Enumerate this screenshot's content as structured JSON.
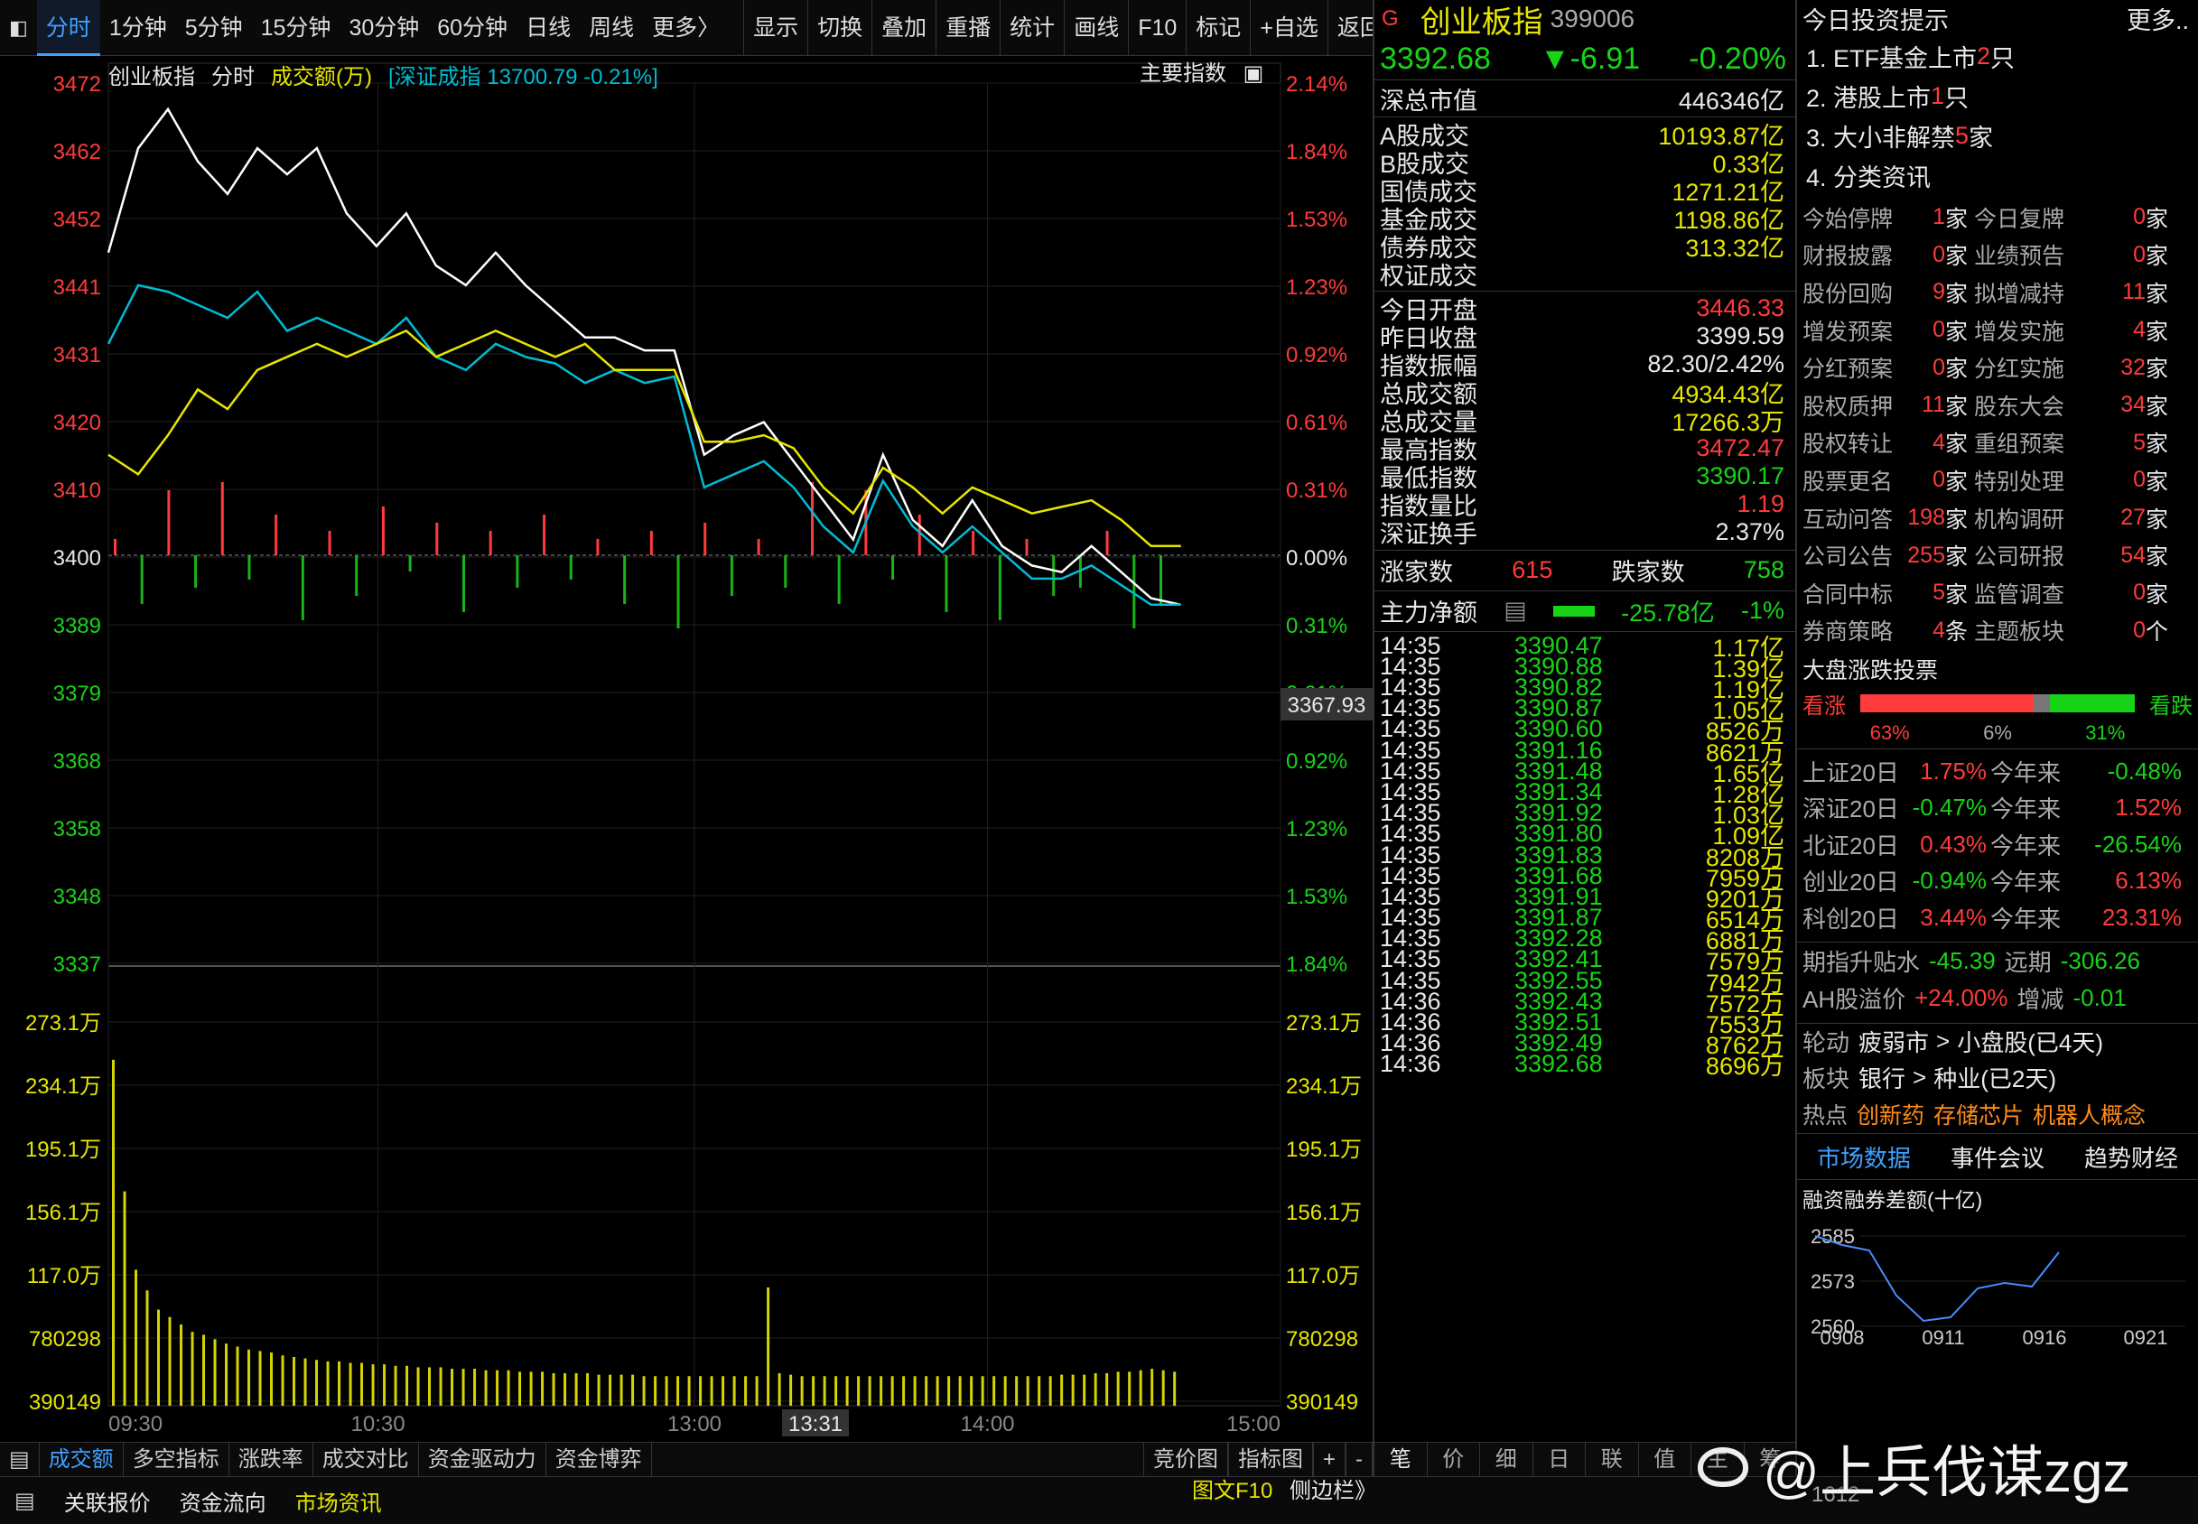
{
  "toolbar": {
    "left_items": [
      "分时",
      "1分钟",
      "5分钟",
      "15分钟",
      "30分钟",
      "60分钟",
      "日线",
      "周线",
      "更多〉"
    ],
    "right_items": [
      "显示",
      "切换",
      "叠加",
      "重播",
      "统计",
      "画线",
      "F10",
      "标记",
      "+自选",
      "返回"
    ]
  },
  "chart_header": {
    "name": "创业板指",
    "mode": "分时",
    "volume_label": "成交额(万)",
    "compare": "[深证成指 13700.79 -0.21%]",
    "index_btn": "主要指数"
  },
  "price_axis_left": [
    "3472",
    "3462",
    "3452",
    "3441",
    "3431",
    "3420",
    "3410",
    "3400",
    "3389",
    "3379",
    "3368",
    "3358",
    "3348",
    "3337"
  ],
  "price_axis_right": [
    "2.14%",
    "1.84%",
    "1.53%",
    "1.23%",
    "0.92%",
    "0.61%",
    "0.31%",
    "0.00%",
    "0.31%",
    "0.61%",
    "0.92%",
    "1.23%",
    "1.53%",
    "1.84%"
  ],
  "volume_axis": [
    "273.1万",
    "234.1万",
    "195.1万",
    "156.1万",
    "117.0万",
    "780298",
    "390149"
  ],
  "time_axis": [
    "09:30",
    "10:30",
    "13:00",
    "14:00",
    "15:00"
  ],
  "cursor_time": "13:31",
  "cursor_price": "3367.93",
  "bottom_tabs": [
    "成交额",
    "多空指标",
    "涨跌率",
    "成交对比",
    "资金驱动力",
    "资金博弈"
  ],
  "bottom_tabs_right": [
    "竞价图",
    "指标图",
    "+",
    "-"
  ],
  "status_bar": [
    "关联报价",
    "资金流向",
    "市场资讯"
  ],
  "status_bar_right": [
    "图文F10",
    "侧边栏》"
  ],
  "quote": {
    "tag": "G",
    "name": "创业板指",
    "code": "399006",
    "price": "3392.68",
    "change": "▼-6.91",
    "pct": "-0.20%"
  },
  "stats": [
    {
      "label": "深总市值",
      "value": "446346亿",
      "color": "white"
    },
    {
      "label": "A股成交",
      "value": "10193.87亿",
      "color": "yellow"
    },
    {
      "label": "B股成交",
      "value": "0.33亿",
      "color": "yellow"
    },
    {
      "label": "国债成交",
      "value": "1271.21亿",
      "color": "yellow"
    },
    {
      "label": "基金成交",
      "value": "1198.86亿",
      "color": "yellow"
    },
    {
      "label": "债券成交",
      "value": "313.32亿",
      "color": "yellow"
    },
    {
      "label": "权证成交",
      "value": "",
      "color": "yellow"
    },
    {
      "label": "今日开盘",
      "value": "3446.33",
      "color": "red"
    },
    {
      "label": "昨日收盘",
      "value": "3399.59",
      "color": "white"
    },
    {
      "label": "指数振幅",
      "value": "82.30/2.42%",
      "color": "white"
    },
    {
      "label": "总成交额",
      "value": "4934.43亿",
      "color": "yellow"
    },
    {
      "label": "总成交量",
      "value": "17266.3万",
      "color": "yellow"
    },
    {
      "label": "最高指数",
      "value": "3472.47",
      "color": "red"
    },
    {
      "label": "最低指数",
      "value": "3390.17",
      "color": "green"
    },
    {
      "label": "指数量比",
      "value": "1.19",
      "color": "red"
    },
    {
      "label": "深证换手",
      "value": "2.37%",
      "color": "white"
    }
  ],
  "updown": {
    "up_label": "涨家数",
    "up": "615",
    "down_label": "跌家数",
    "down": "758"
  },
  "main_flow": {
    "label": "主力净额",
    "value": "-25.78亿",
    "pct": "-1%"
  },
  "ticks": [
    {
      "time": "14:35",
      "price": "3390.47",
      "amount": "1.17亿"
    },
    {
      "time": "14:35",
      "price": "3390.88",
      "amount": "1.39亿"
    },
    {
      "time": "14:35",
      "price": "3390.82",
      "amount": "1.19亿"
    },
    {
      "time": "14:35",
      "price": "3390.87",
      "amount": "1.05亿"
    },
    {
      "time": "14:35",
      "price": "3390.60",
      "amount": "8526万"
    },
    {
      "time": "14:35",
      "price": "3391.16",
      "amount": "8621万"
    },
    {
      "time": "14:35",
      "price": "3391.48",
      "amount": "1.65亿"
    },
    {
      "time": "14:35",
      "price": "3391.34",
      "amount": "1.28亿"
    },
    {
      "time": "14:35",
      "price": "3391.92",
      "amount": "1.03亿"
    },
    {
      "time": "14:35",
      "price": "3391.80",
      "amount": "1.09亿"
    },
    {
      "time": "14:35",
      "price": "3391.83",
      "amount": "8208万"
    },
    {
      "time": "14:35",
      "price": "3391.68",
      "amount": "7959万"
    },
    {
      "time": "14:35",
      "price": "3391.91",
      "amount": "9201万"
    },
    {
      "time": "14:35",
      "price": "3391.87",
      "amount": "6514万"
    },
    {
      "time": "14:35",
      "price": "3392.28",
      "amount": "6881万"
    },
    {
      "time": "14:35",
      "price": "3392.41",
      "amount": "7579万"
    },
    {
      "time": "14:35",
      "price": "3392.55",
      "amount": "7942万"
    },
    {
      "time": "14:36",
      "price": "3392.43",
      "amount": "7572万"
    },
    {
      "time": "14:36",
      "price": "3392.51",
      "amount": "7553万"
    },
    {
      "time": "14:36",
      "price": "3392.49",
      "amount": "8762万"
    },
    {
      "time": "14:36",
      "price": "3392.68",
      "amount": "8696万"
    }
  ],
  "mid_bottom_tabs": [
    "笔",
    "价",
    "细",
    "日",
    "联",
    "值",
    "主",
    "筹"
  ],
  "hints": {
    "title": "今日投资提示",
    "more": "更多..",
    "items": [
      {
        "pre": "1. ETF基金上市",
        "num": "2",
        "post": "只"
      },
      {
        "pre": "2. 港股上市",
        "num": "1",
        "post": "只"
      },
      {
        "pre": "3. 大小非解禁",
        "num": "5",
        "post": "家"
      },
      {
        "pre": "4. 分类资讯",
        "num": "",
        "post": ""
      }
    ]
  },
  "events": [
    [
      "今始停牌",
      "1",
      "家",
      "今日复牌",
      "0",
      "家"
    ],
    [
      "财报披露",
      "0",
      "家",
      "业绩预告",
      "0",
      "家"
    ],
    [
      "股份回购",
      "9",
      "家",
      "拟增减持",
      "11",
      "家"
    ],
    [
      "增发预案",
      "0",
      "家",
      "增发实施",
      "4",
      "家"
    ],
    [
      "分红预案",
      "0",
      "家",
      "分红实施",
      "32",
      "家"
    ],
    [
      "股权质押",
      "11",
      "家",
      "股东大会",
      "34",
      "家"
    ],
    [
      "股权转让",
      "4",
      "家",
      "重组预案",
      "5",
      "家"
    ],
    [
      "股票更名",
      "0",
      "家",
      "特别处理",
      "0",
      "家"
    ],
    [
      "互动问答",
      "198",
      "家",
      "机构调研",
      "27",
      "家"
    ],
    [
      "公司公告",
      "255",
      "家",
      "公司研报",
      "54",
      "家"
    ],
    [
      "合同中标",
      "5",
      "家",
      "监管调查",
      "0",
      "家"
    ],
    [
      "券商策略",
      "4",
      "条",
      "主题板块",
      "0",
      "个"
    ]
  ],
  "vote": {
    "title": "大盘涨跌投票",
    "up_label": "看涨",
    "down_label": "看跌",
    "up_pct": "63%",
    "flat_pct": "6%",
    "down_pct": "31%",
    "up_frac": 0.63,
    "flat_frac": 0.06,
    "down_frac": 0.31
  },
  "index20": [
    [
      "上证20日",
      "1.75%",
      "red",
      "今年来",
      "-0.48%",
      "green"
    ],
    [
      "深证20日",
      "-0.47%",
      "green",
      "今年来",
      "1.52%",
      "red"
    ],
    [
      "北证20日",
      "0.43%",
      "red",
      "今年来",
      "-26.54%",
      "green"
    ],
    [
      "创业20日",
      "-0.94%",
      "green",
      "今年来",
      "6.13%",
      "red"
    ],
    [
      "科创20日",
      "3.44%",
      "red",
      "今年来",
      "23.31%",
      "red"
    ]
  ],
  "futures": {
    "label": "期指升贴水",
    "v1": "-45.39",
    "label2": "远期",
    "v2": "-306.26"
  },
  "ah": {
    "label": "AH股溢价",
    "v1": "+24.00%",
    "label2": "增减",
    "v2": "-0.01"
  },
  "rotation": [
    {
      "k": "轮动",
      "a": "疲弱市",
      "b": "小盘股(已4天)"
    },
    {
      "k": "板块",
      "a": "银行",
      "b": "种业(已2天)"
    }
  ],
  "hot": {
    "k": "热点",
    "items": [
      "创新药",
      "存储芯片",
      "机器人概念"
    ]
  },
  "news_tabs": [
    "市场数据",
    "事件会议",
    "趋势财经"
  ],
  "margin_chart": {
    "title": "融资融券差额(十亿)",
    "y_ticks": [
      "2585",
      "2573",
      "2560"
    ],
    "x_ticks": [
      "0908",
      "0911",
      "0916",
      "0921"
    ],
    "bottom_label": "1612"
  },
  "watermark": "@上兵伐谋zgz",
  "chart_data": {
    "type": "line",
    "title": "创业板指 分时",
    "ylim": [
      3337,
      3472
    ],
    "prev_close": 3399.59,
    "x_labels": [
      "09:30",
      "10:30",
      "13:00",
      "14:00",
      "15:00"
    ],
    "series": [
      {
        "name": "创业板指",
        "color": "#ffffff",
        "values": [
          3446,
          3462,
          3468,
          3460,
          3455,
          3462,
          3458,
          3462,
          3452,
          3447,
          3452,
          3444,
          3441,
          3446,
          3441,
          3437,
          3433,
          3433,
          3431,
          3431,
          3415,
          3418,
          3420,
          3414,
          3408,
          3402,
          3415,
          3405,
          3401,
          3408,
          3401,
          3398,
          3397,
          3401,
          3397,
          3393,
          3392
        ]
      },
      {
        "name": "深证成指",
        "color": "#00bcd4",
        "values": [
          3432,
          3441,
          3440,
          3438,
          3436,
          3440,
          3434,
          3436,
          3434,
          3432,
          3436,
          3430,
          3428,
          3432,
          3430,
          3429,
          3426,
          3428,
          3426,
          3427,
          3410,
          3412,
          3414,
          3410,
          3404,
          3400,
          3411,
          3404,
          3400,
          3404,
          3400,
          3396,
          3396,
          3398,
          3395,
          3392,
          3392
        ]
      },
      {
        "name": "均线",
        "color": "#e6e600",
        "values": [
          3415,
          3412,
          3418,
          3425,
          3422,
          3428,
          3430,
          3432,
          3430,
          3432,
          3434,
          3430,
          3432,
          3434,
          3432,
          3430,
          3432,
          3428,
          3428,
          3428,
          3417,
          3417,
          3418,
          3416,
          3410,
          3406,
          3413,
          3410,
          3406,
          3410,
          3408,
          3406,
          3407,
          3408,
          3405,
          3401,
          3401
        ]
      }
    ],
    "diff_bars": [
      0.2,
      -0.6,
      0.8,
      -0.4,
      0.9,
      -0.3,
      0.5,
      -0.8,
      0.3,
      -0.5,
      0.6,
      -0.2,
      0.4,
      -0.7,
      0.3,
      -0.4,
      0.5,
      -0.3,
      0.2,
      -0.6,
      0.3,
      -0.9,
      0.4,
      -0.5,
      0.2,
      -0.4,
      0.9,
      -0.6,
      0.8,
      -0.3,
      0.5,
      -0.7,
      0.3,
      -0.8,
      0.2,
      -0.5,
      -0.4,
      0.3,
      -0.9,
      -0.6
    ],
    "volume": [
      2.34,
      1.45,
      0.92,
      0.78,
      0.65,
      0.6,
      0.55,
      0.5,
      0.48,
      0.45,
      0.42,
      0.4,
      0.38,
      0.37,
      0.36,
      0.34,
      0.33,
      0.32,
      0.31,
      0.3,
      0.3,
      0.29,
      0.29,
      0.28,
      0.28,
      0.27,
      0.27,
      0.26,
      0.26,
      0.26,
      0.25,
      0.25,
      0.25,
      0.24,
      0.24,
      0.24,
      0.23,
      0.23,
      0.23,
      0.22,
      0.22,
      0.22,
      0.22,
      0.21,
      0.21,
      0.21,
      0.21,
      0.2,
      0.2,
      0.2,
      0.2,
      0.2,
      0.2,
      0.2,
      0.2,
      0.2,
      0.2,
      0.2,
      0.8,
      0.22,
      0.21,
      0.2,
      0.2,
      0.2,
      0.2,
      0.2,
      0.2,
      0.2,
      0.2,
      0.2,
      0.2,
      0.2,
      0.2,
      0.2,
      0.2,
      0.2,
      0.2,
      0.2,
      0.2,
      0.2,
      0.2,
      0.2,
      0.2,
      0.2,
      0.21,
      0.21,
      0.21,
      0.22,
      0.22,
      0.23,
      0.23,
      0.24,
      0.25,
      0.24,
      0.23
    ]
  }
}
